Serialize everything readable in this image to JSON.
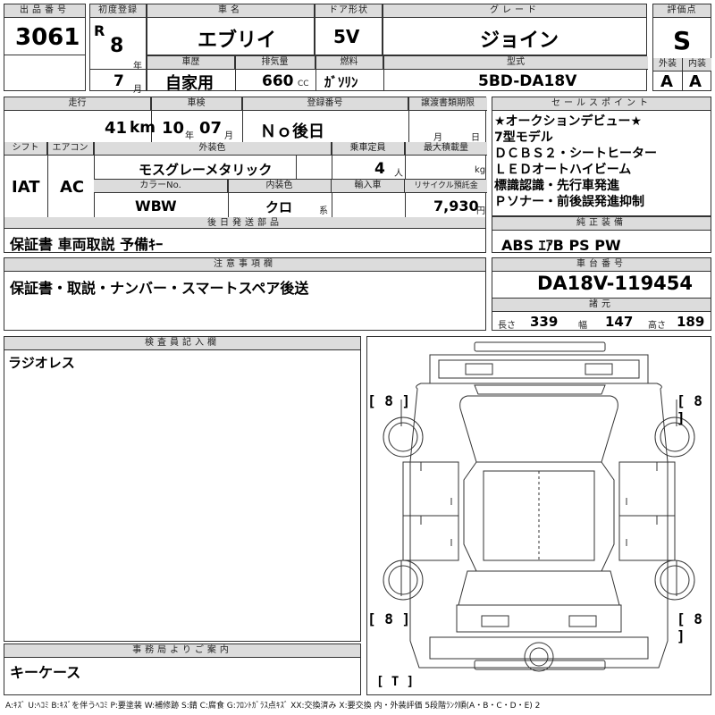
{
  "header": {
    "lot_no_label": "出品番号",
    "lot_no": "3061",
    "first_reg_label": "初度登録",
    "era": "R",
    "year": "8",
    "year_unit": "年",
    "month": "7",
    "month_unit": "月",
    "car_name_label": "車名",
    "car_name": "エブリイ",
    "door_label": "ドア形状",
    "door": "5V",
    "grade_label": "グレード",
    "grade": "ジョイン",
    "score_label": "評価点",
    "score": "S",
    "history_label": "車歴",
    "history": "自家用",
    "displacement_label": "排気量",
    "displacement": "660",
    "cc": "CC",
    "fuel_label": "燃料",
    "fuel": "ｶﾞｿﾘﾝ",
    "model_label": "型式",
    "model": "5BD-DA18V",
    "ext_label": "外装",
    "ext": "A",
    "int_label": "内装",
    "int": "A"
  },
  "detail": {
    "mileage_label": "走行",
    "mileage": "41",
    "km": "km",
    "inspection_label": "車検",
    "insp_year": "10",
    "insp_year_unit": "年",
    "insp_month": "07",
    "insp_month_unit": "月",
    "reg_no_label": "登録番号",
    "reg_no": "Ｎｏ後日",
    "transfer_label": "譲渡書類期限",
    "transfer_month": "月",
    "transfer_day": "日",
    "shift_label": "シフト",
    "shift": "IAT",
    "ac_label": "エアコン",
    "ac": "AC",
    "color_label": "外装色",
    "color": "モスグレーメタリック",
    "capacity_label": "乗車定員",
    "capacity": "4",
    "capacity_unit": "人",
    "load_label": "最大積載量",
    "load_unit": "kg",
    "color_no_label": "カラーNo.",
    "color_no": "WBW",
    "interior_label": "内装色",
    "interior": "クロ",
    "interior_unit": "系",
    "import_label": "輸入車",
    "recycle_label": "リサイクル預託金",
    "recycle": "7,930",
    "recycle_unit": "円",
    "later_label": "後日発送部品",
    "later": "保証書 車両取説 予備ｷｰ"
  },
  "sales": {
    "label": "セールスポイント",
    "lines": [
      "★オークションデビュー★",
      "7型モデル",
      "ＤＣＢＳ２・シートヒーター",
      "ＬＥＤオートハイビーム",
      "標識認識・先行車発進",
      "Ｐソナー・前後誤発進抑制"
    ]
  },
  "equipment": {
    "label": "純正装備",
    "value": "ABS ｴｱB PS PW"
  },
  "notes": {
    "label": "注意事項欄",
    "value": "保証書・取説・ナンバー・スマートスペア後送"
  },
  "chassis": {
    "label": "車台番号",
    "value": "DA18V-119454",
    "dims_label": "諸元",
    "length_label": "長さ",
    "length": "339",
    "width_label": "幅",
    "width": "147",
    "height_label": "高さ",
    "height": "189"
  },
  "inspector": {
    "label": "検査員記入欄",
    "value": "ラジオレス"
  },
  "office": {
    "label": "事務局よりご案内",
    "value": "キーケース"
  },
  "diagram": {
    "tire_fl": "[ 8 ]",
    "tire_fr": "[ 8 ]",
    "tire_rl": "[ 8 ]",
    "tire_rr": "[ 8 ]",
    "spare": "[ T ]"
  },
  "footer": "A:ｷｽﾞ U:ﾍｺﾐ B:ｷｽﾞを伴うﾍｺﾐ P:要塗装 W:補修跡 S:錆 C:腐食 G:ﾌﾛﾝﾄｶﾞﾗｽ点ｷｽﾞ XX:交換済み X:要交換 内・外装評価 5段階ﾗﾝｸ順(A・B・C・D・E) 2"
}
